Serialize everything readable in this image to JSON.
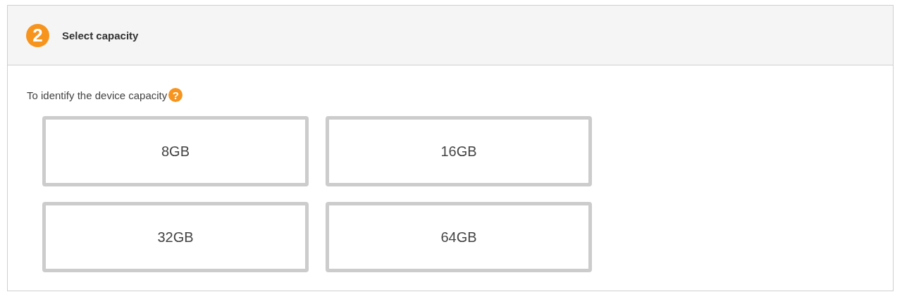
{
  "step": {
    "number": "2",
    "title": "Select capacity"
  },
  "prompt": {
    "text": "To identify the device capacity",
    "help": "?"
  },
  "options": [
    {
      "label": "8GB",
      "selected": false
    },
    {
      "label": "16GB",
      "selected": false
    },
    {
      "label": "32GB",
      "selected": false
    },
    {
      "label": "64GB",
      "selected": false
    }
  ]
}
